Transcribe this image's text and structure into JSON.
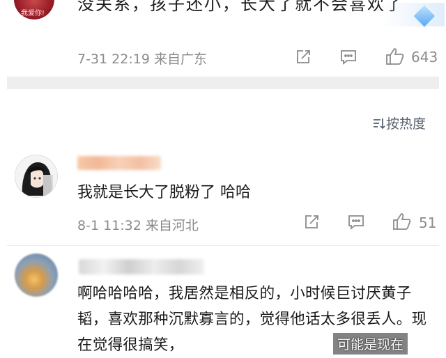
{
  "top_comment": {
    "avatar_text": "我爱你!",
    "text": "没关系，孩子还小，长大了就不会喜欢了",
    "meta": "7-31 22:19 来自广东",
    "likes": "643",
    "icons": [
      "share-icon",
      "comment-icon",
      "like-icon"
    ]
  },
  "sort": {
    "label": "按热度",
    "icon": "sort-icon"
  },
  "comments": [
    {
      "text": "我就是长大了脱粉了 哈哈",
      "meta": "8-1 11:32 来自河北",
      "likes": "51"
    },
    {
      "text": "啊哈哈哈哈，我居然是相反的，小时候巨讨厌黄子韬，喜欢那种沉默寡言的，觉得他话太多很丢人。现在觉得很搞笑，",
      "watermark": "可能是现在"
    }
  ]
}
